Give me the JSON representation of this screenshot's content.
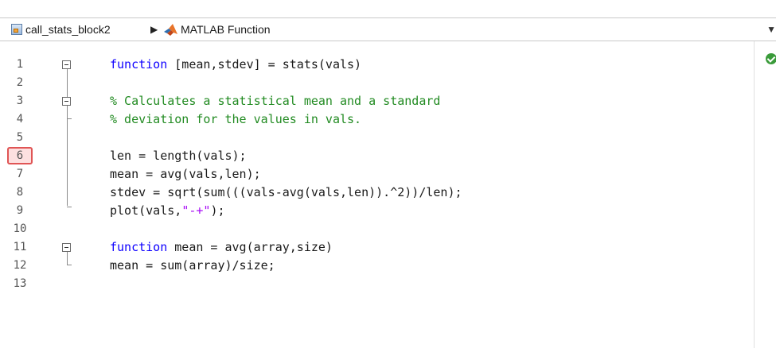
{
  "breadcrumb": {
    "model_name": "call_stats_block2",
    "separator": "▶",
    "block_name": "MATLAB Function",
    "dropdown": "▼"
  },
  "editor": {
    "line_numbers": [
      "1",
      "2",
      "3",
      "4",
      "5",
      "6",
      "7",
      "8",
      "9",
      "10",
      "11",
      "12",
      "13"
    ],
    "breakpoint_line": "6",
    "code": {
      "l1_kw": "function",
      "l1_rest": " [mean,stdev] = stats(vals)",
      "l3": "% Calculates a statistical mean and a standard",
      "l4": "% deviation for the values in vals.",
      "l6": "len = length(vals);",
      "l7": "mean = avg(vals,len);",
      "l8": "stdev = sqrt(sum(((vals-avg(vals,len)).^2))/len);",
      "l9_a": "plot(vals,",
      "l9_str": "\"-+\"",
      "l9_b": ");",
      "l11_kw": "function",
      "l11_rest": " mean = avg(array,size)",
      "l12": "mean = sum(array)/size;"
    },
    "status_icon": "check-circle-icon"
  },
  "colors": {
    "keyword": "#0e00ff",
    "comment": "#228b22",
    "string": "#a709f5",
    "breakpoint": "#e05555"
  }
}
